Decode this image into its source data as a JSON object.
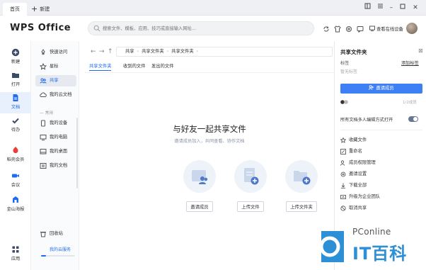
{
  "titlebar": {
    "home_tab": "首页",
    "new_tab": "新建",
    "window_controls": [
      "restore-icon",
      "menu-icon",
      "minimize-icon",
      "maximize-icon",
      "close-icon"
    ]
  },
  "header": {
    "logo": "WPS Office",
    "search_placeholder": "搜索文件、模板、应用、技巧或直接输入网址...",
    "view_other_devices": "查看在线设备"
  },
  "rail": [
    {
      "label": "新建",
      "icon": "plus-circle-icon"
    },
    {
      "label": "打开",
      "icon": "folder-icon"
    },
    {
      "label": "文档",
      "icon": "document-icon",
      "active": true
    },
    {
      "label": "待办",
      "icon": "check-icon"
    },
    {
      "label": "稻壳会员",
      "icon": "daoke-icon"
    },
    {
      "label": "会议",
      "icon": "video-icon"
    },
    {
      "label": "金山海报",
      "icon": "poster-icon"
    },
    {
      "label": "应用",
      "icon": "apps-grid-icon"
    }
  ],
  "sidebar": {
    "items_top": [
      {
        "label": "快速访问",
        "icon": "pin-icon"
      },
      {
        "label": "星标",
        "icon": "star-icon"
      },
      {
        "label": "共享",
        "icon": "share-icon",
        "active": true
      },
      {
        "label": "我的云文档",
        "icon": "cloud-icon"
      }
    ],
    "section_label": "常用",
    "items_common": [
      {
        "label": "我的设备",
        "icon": "device-icon"
      },
      {
        "label": "我的电脑",
        "icon": "computer-icon"
      },
      {
        "label": "我的桌面",
        "icon": "desktop-icon"
      },
      {
        "label": "我的文档",
        "icon": "mydocs-icon"
      }
    ],
    "recycle": "回收站",
    "cloud_space": "我的云服务",
    "cloud_usage_fraction": 0.15
  },
  "main": {
    "breadcrumb": [
      "共享",
      "共享文件夹",
      "共享文件夹"
    ],
    "tabs": [
      {
        "label": "共享文件夹",
        "active": true
      },
      {
        "label": "收到的文件"
      },
      {
        "label": "发出的文件"
      }
    ],
    "empty_title": "与好友一起共享文件",
    "empty_subtitle": "邀请成员加入，共同查看、协作文档",
    "actions": [
      {
        "label": "邀请成员",
        "icon": "invite-members-icon"
      },
      {
        "label": "上传文件",
        "icon": "upload-file-icon"
      },
      {
        "label": "上传文件夹",
        "icon": "upload-folder-icon"
      }
    ]
  },
  "right_panel": {
    "title": "共享文件夹",
    "tag_label": "标签",
    "add_tag": "添加标签",
    "no_tag": "暂无标签",
    "invite_button": "邀请成员",
    "member_count": "1/2成员",
    "multi_edit_label": "所有文档多人编辑方式打开",
    "multi_edit_on": true,
    "actions": [
      {
        "label": "收藏文件",
        "icon": "star-outline-icon"
      },
      {
        "label": "重命名",
        "icon": "rename-icon"
      },
      {
        "label": "成员权限管理",
        "icon": "member-permission-icon"
      },
      {
        "label": "邀请设置",
        "icon": "invite-settings-icon"
      },
      {
        "label": "下载全部",
        "icon": "download-icon"
      },
      {
        "label": "升级为企业团队",
        "icon": "upgrade-icon"
      },
      {
        "label": "取消共享",
        "icon": "cancel-share-icon"
      }
    ]
  },
  "watermark": {
    "top": "PConline",
    "bottom": "IT百科"
  },
  "colors": {
    "accent": "#1f6bef",
    "invite_button": "#3d7ff5",
    "watermark": "#2d8fd5"
  }
}
